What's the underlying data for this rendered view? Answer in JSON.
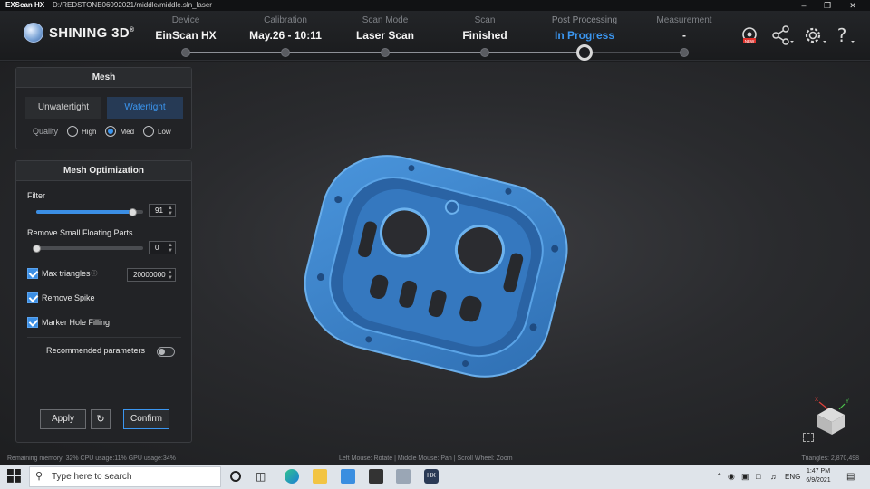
{
  "titlebar": {
    "app": "EXScan HX",
    "path": "D:/REDSTONE06092021/middle/middle.sln_laser"
  },
  "brand": {
    "name": "SHINING 3D",
    "trademark": "®"
  },
  "steps": [
    {
      "label": "Device",
      "value": "EinScan HX",
      "state": "done"
    },
    {
      "label": "Calibration",
      "value": "May.26 - 10:11",
      "state": "done"
    },
    {
      "label": "Scan Mode",
      "value": "Laser Scan",
      "state": "done"
    },
    {
      "label": "Scan",
      "value": "Finished",
      "state": "done"
    },
    {
      "label": "Post Processing",
      "value": "In Progress",
      "state": "active"
    },
    {
      "label": "Measurement",
      "value": "-",
      "state": "pending"
    }
  ],
  "header_icons": [
    "new-feature-icon",
    "share-icon",
    "settings-icon",
    "help-icon"
  ],
  "mesh_panel": {
    "title": "Mesh",
    "options": [
      "Unwatertight",
      "Watertight"
    ],
    "selected": "Watertight",
    "quality_label": "Quality",
    "quality_options": [
      "High",
      "Med",
      "Low"
    ],
    "quality_selected": "Med"
  },
  "opt_panel": {
    "title": "Mesh Optimization",
    "filter_label": "Filter",
    "filter_value": "91",
    "filter_fraction": 0.91,
    "floating_label": "Remove Small Floating Parts",
    "floating_value": "0",
    "floating_fraction": 0.0,
    "max_triangles_label": "Max triangles",
    "max_triangles_value": "20000000",
    "max_triangles_checked": true,
    "remove_spike_label": "Remove Spike",
    "remove_spike_checked": true,
    "marker_hole_label": "Marker Hole Filling",
    "marker_hole_checked": true,
    "recommended_label": "Recommended parameters",
    "recommended_on": false,
    "apply_label": "Apply",
    "confirm_label": "Confirm"
  },
  "status": {
    "left": "Remaining memory: 32%  CPU usage:11%  GPU usage:34%",
    "center": "Left Mouse: Rotate | Middle Mouse: Pan | Scroll Wheel: Zoom",
    "right": "Triangles: 2,870,498"
  },
  "taskbar": {
    "search_placeholder": "Type here to search",
    "language": "ENG",
    "time": "1:47 PM",
    "date": "6/9/2021"
  },
  "colors": {
    "accent": "#3b96f0",
    "model": "#3f86cf"
  }
}
